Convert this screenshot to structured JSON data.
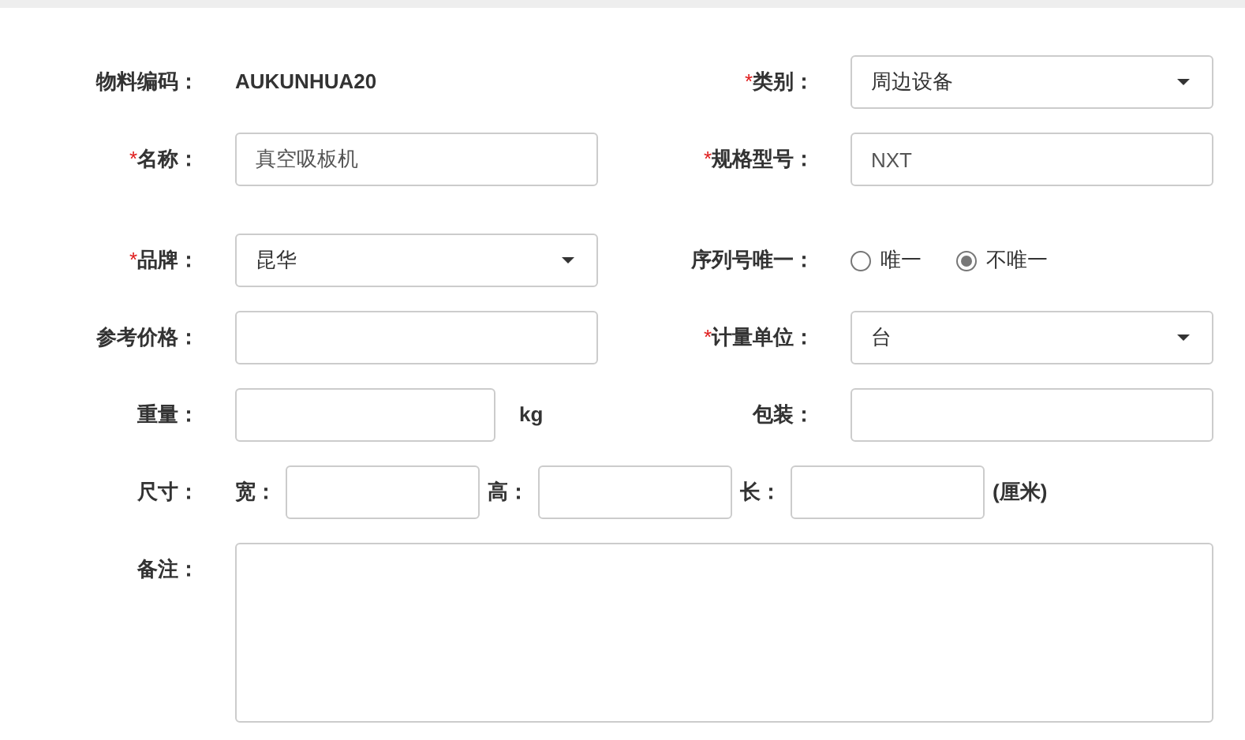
{
  "rows": [
    {
      "cells": [
        {
          "kind": "static",
          "label": "物料编码：",
          "value": "AUKUNHUA20"
        },
        {
          "kind": "select",
          "required_mark": "*",
          "label": "类别：",
          "value": "周边设备"
        }
      ]
    },
    {
      "cells": [
        {
          "kind": "input",
          "required_mark": "*",
          "label": "名称：",
          "value": "真空吸板机"
        },
        {
          "kind": "input",
          "required_mark": "*",
          "label": "规格型号：",
          "value": "NXT"
        }
      ]
    },
    {
      "cells": [
        {
          "kind": "select",
          "required_mark": "*",
          "label": "品牌：",
          "value": "昆华"
        },
        {
          "kind": "radio",
          "label": "序列号唯一：",
          "options": [
            {
              "label": "唯一",
              "selected": false
            },
            {
              "label": "不唯一",
              "selected": true
            }
          ]
        }
      ]
    },
    {
      "cells": [
        {
          "kind": "input",
          "label": "参考价格："
        },
        {
          "kind": "select",
          "required_mark": "*",
          "label": "计量单位：",
          "value": "台"
        }
      ]
    },
    {
      "cells": [
        {
          "kind": "unit_input",
          "label": "重量：",
          "unit": "kg"
        },
        {
          "kind": "input",
          "label": "包装："
        }
      ]
    },
    {
      "cells": [
        {
          "kind": "dimensions",
          "label": "尺寸：",
          "parts": [
            {
              "label": "宽："
            },
            {
              "label": "高："
            },
            {
              "label": "长："
            }
          ],
          "unit": "(厘米)"
        }
      ]
    },
    {
      "cells": [
        {
          "kind": "textarea",
          "label": "备注："
        }
      ]
    }
  ]
}
